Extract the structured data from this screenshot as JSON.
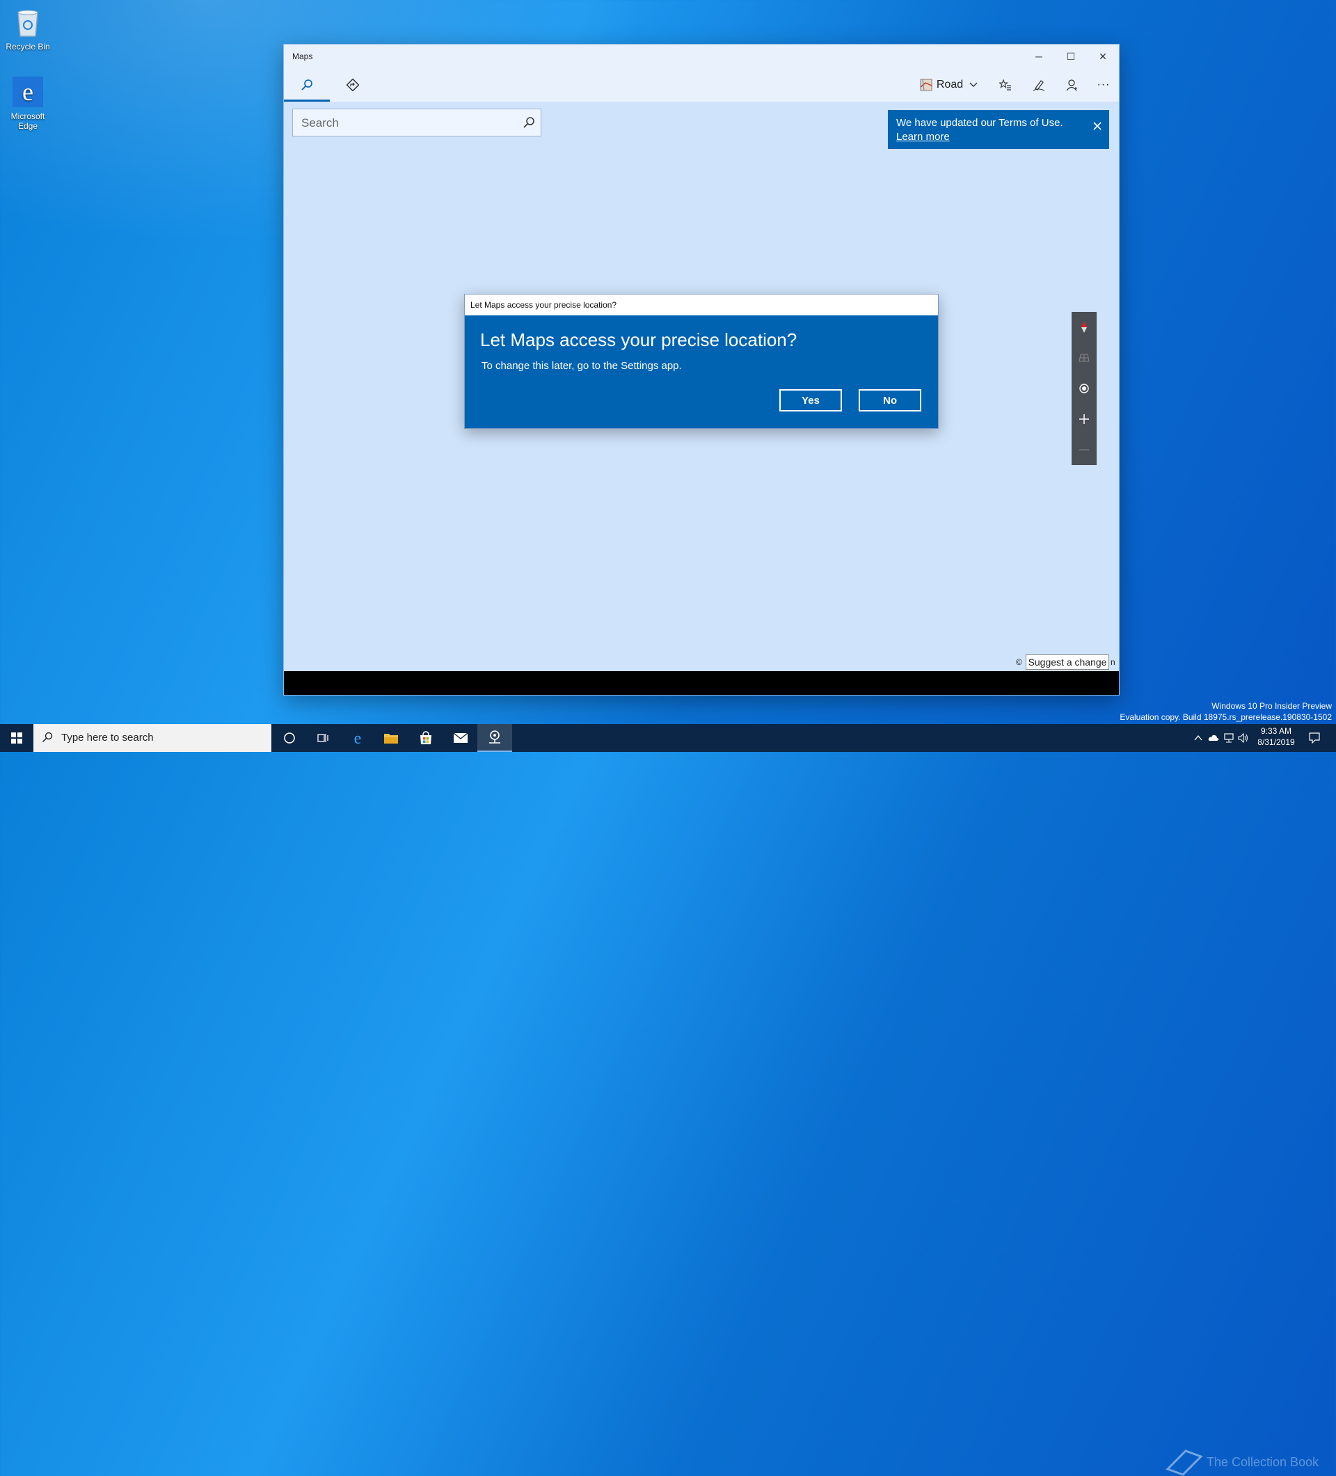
{
  "desktop": {
    "icons": [
      {
        "label": "Recycle Bin"
      },
      {
        "label": "Microsoft Edge"
      }
    ]
  },
  "window": {
    "title": "Maps",
    "controls": {
      "minimize": "─",
      "maximize": "☐",
      "close": "✕"
    },
    "toolbar": {
      "tabs": [
        {
          "name": "search-tab",
          "icon": "search-icon"
        },
        {
          "name": "directions-tab",
          "icon": "directions-icon"
        }
      ],
      "map_style_label": "Road",
      "actions": [
        "favorites-icon",
        "ink-icon",
        "account-icon",
        "more-icon"
      ],
      "more_glyph": "···"
    },
    "search": {
      "placeholder": "Search",
      "value": ""
    },
    "notice": {
      "text": "We have updated our Terms of Use.",
      "link": "Learn more"
    },
    "map_footer": {
      "copyright_left": "© ",
      "copyright_right": "n",
      "suggest": "Suggest a change"
    }
  },
  "dialog": {
    "title": "Let Maps access your precise location?",
    "heading": "Let Maps access your precise location?",
    "body": "To change this later, go to the Settings app.",
    "yes": "Yes",
    "no": "No"
  },
  "taskbar": {
    "search_placeholder": "Type here to search",
    "time": "9:33 AM",
    "date": "8/31/2019",
    "pinned": [
      "cortana-icon",
      "task-view-icon",
      "edge-icon",
      "file-explorer-icon",
      "store-icon",
      "mail-icon",
      "maps-icon"
    ]
  },
  "watermark": {
    "line1": "Windows 10 Pro Insider Preview",
    "line2": "Evaluation copy. Build 18975.rs_prerelease.190830-1502"
  },
  "brand_overlay": "The Collection Book",
  "colors": {
    "accent": "#0063b1",
    "taskbar": "#0b2646",
    "map_bg": "#cfe3fa"
  }
}
